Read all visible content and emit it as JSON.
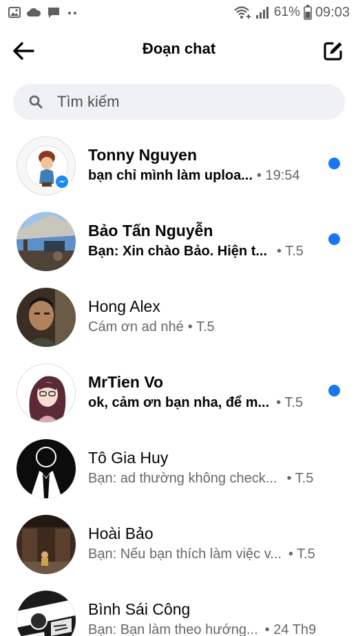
{
  "status_bar": {
    "battery_percent": "61%",
    "time": "09:03",
    "left_icons": [
      "image-notification-icon",
      "cloud-icon",
      "message-notification-icon",
      "more-dots-icon"
    ],
    "right_icons": [
      "wifi-plus-icon",
      "signal-icon",
      "battery-icon"
    ]
  },
  "header": {
    "title": "Đoạn chat",
    "back_icon": "back-arrow-icon",
    "compose_icon": "compose-icon"
  },
  "search": {
    "placeholder": "Tìm kiếm",
    "value": ""
  },
  "colors": {
    "unread_dot": "#1877f2",
    "search_bg": "#eff1f4",
    "secondary_text": "#65676b"
  },
  "conversations": [
    {
      "name": "Tonny Nguyen",
      "message": "bạn chỉ mình làm uploa...",
      "time": "• 19:54",
      "unread": true,
      "avatar": "cartoon-avatar"
    },
    {
      "name": "Bảo Tấn Nguyễn",
      "message": "Bạn: Xin chào Bảo. Hiện t...",
      "time": "• T.5",
      "unread": true,
      "avatar": "photo-avatar"
    },
    {
      "name": "Hong Alex",
      "message": "Cám ơn ad nhé",
      "time": "• T.5",
      "unread": false,
      "avatar": "photo-avatar"
    },
    {
      "name": "MrTien Vo",
      "message": "ok, cảm ơn bạn nha, để m...",
      "time": "• T.5",
      "unread": true,
      "avatar": "anime-avatar"
    },
    {
      "name": "Tô Gia Huy",
      "message": "Bạn: ad thường không check...",
      "time": "• T.5",
      "unread": false,
      "avatar": "suit-avatar"
    },
    {
      "name": "Hoài Bảo",
      "message": "Bạn: Nếu bạn thích làm việc v...",
      "time": "• T.5",
      "unread": false,
      "avatar": "photo-avatar"
    },
    {
      "name": "Bình Sái Công",
      "message": "Bạn: Bạn làm theo hướng...",
      "time": "• 24 Th9",
      "unread": false,
      "avatar": "comic-avatar"
    }
  ]
}
